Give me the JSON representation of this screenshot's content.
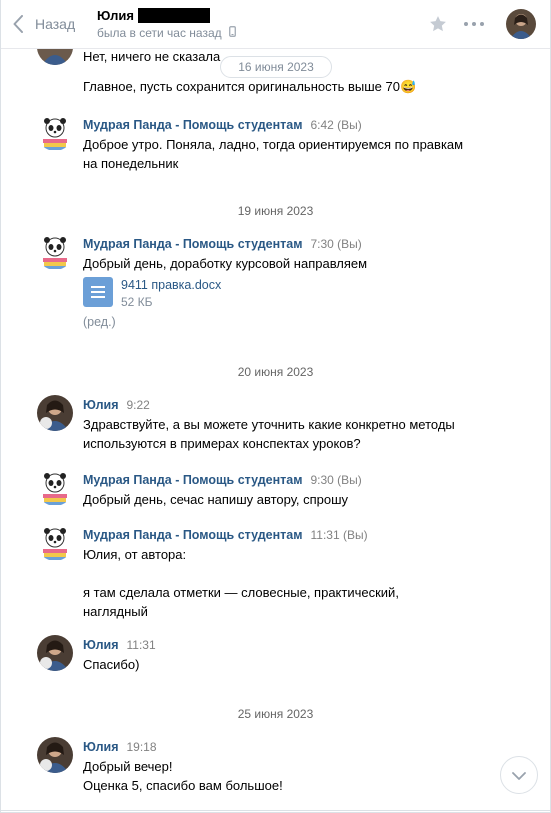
{
  "header": {
    "back_label": "Назад",
    "contact_name": "Юлия",
    "status": "была в сети час назад"
  },
  "partial_top": {
    "text": "Нет, ничего не сказала",
    "date_pill": "16 июня 2023",
    "text2": "Главное, пусть сохранится оригинальность выше 70😅"
  },
  "messages": [
    {
      "author": "Мудрая Панда - Помощь студентам",
      "time": "6:42 (Вы)",
      "text": "Доброе утро. Поняла, ладно, тогда ориентируемся по правкам\nна понедельник"
    },
    {
      "date": "19 июня 2023",
      "author": "Мудрая Панда - Помощь студентам",
      "time": "7:30 (Вы)",
      "text": "Добрый день, доработку курсовой направляем",
      "doc_name": "9411 правка.docx",
      "doc_size": "52 КБ",
      "edited": "(ред.)"
    },
    {
      "date": "20 июня 2023",
      "author": "Юлия",
      "time": "9:22",
      "text": "Здравствуйте, а вы можете уточнить какие конкретно методы\nиспользуются в примерах конспектах уроков?"
    },
    {
      "author": "Мудрая Панда - Помощь студентам",
      "time": "9:30 (Вы)",
      "text": "Добрый день, сечас напишу автору, спрошу"
    },
    {
      "author": "Мудрая Панда - Помощь студентам",
      "time": "11:31 (Вы)",
      "text": "Юлия, от автора:\n\nя там сделала отметки — словесные, практический,\nнаглядный"
    },
    {
      "author": "Юлия",
      "time": "11:31",
      "text": "Спасибо)"
    },
    {
      "date": "25 июня 2023",
      "author": "Юлия",
      "time": "19:18",
      "text": "Добрый вечер!\nОценка 5, спасибо вам большое!"
    }
  ],
  "colors": {
    "link": "#2a5885",
    "meta": "#818c99",
    "doc_icon": "#6b9fd7"
  }
}
